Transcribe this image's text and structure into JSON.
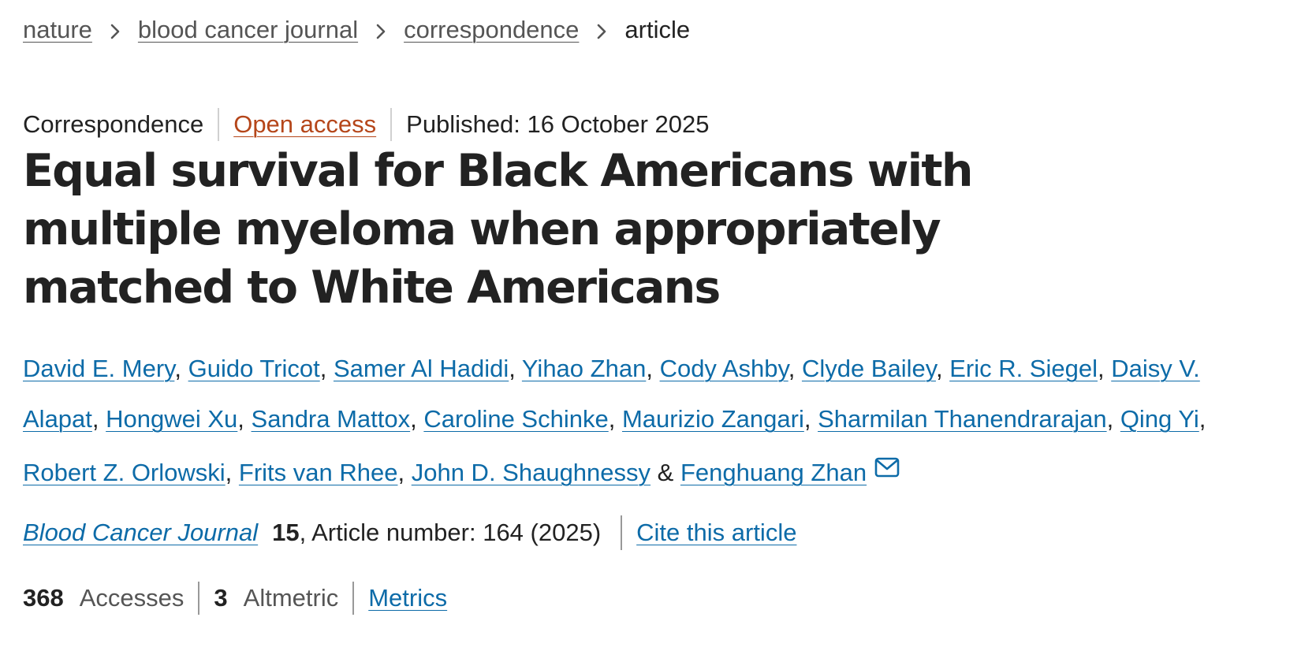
{
  "breadcrumb": {
    "items": [
      {
        "label": "nature"
      },
      {
        "label": "blood cancer journal"
      },
      {
        "label": "correspondence"
      }
    ],
    "current": "article"
  },
  "article": {
    "type": "Correspondence",
    "access": "Open access",
    "published": "Published: 16 October 2025",
    "title": "Equal survival for Black Americans with multiple myeloma when appropriately matched to White Americans"
  },
  "authors": [
    {
      "name": "David E. Mery"
    },
    {
      "name": "Guido Tricot"
    },
    {
      "name": "Samer Al Hadidi"
    },
    {
      "name": "Yihao Zhan"
    },
    {
      "name": "Cody Ashby"
    },
    {
      "name": "Clyde Bailey"
    },
    {
      "name": "Eric R. Siegel"
    },
    {
      "name": "Daisy V. Alapat"
    },
    {
      "name": "Hongwei Xu"
    },
    {
      "name": "Sandra Mattox"
    },
    {
      "name": "Caroline Schinke"
    },
    {
      "name": "Maurizio Zangari"
    },
    {
      "name": "Sharmilan Thanendrarajan"
    },
    {
      "name": "Qing Yi"
    },
    {
      "name": "Robert Z. Orlowski"
    },
    {
      "name": "Frits van Rhee"
    },
    {
      "name": "John D. Shaughnessy"
    },
    {
      "name": "Fenghuang Zhan"
    }
  ],
  "authors_separator": ", ",
  "authors_last_separator": " & ",
  "authors_contact_icon": "mail-icon",
  "citation": {
    "journal": "Blood Cancer Journal",
    "volume": "15",
    "article_number": ", Article number: 164 (2025)",
    "cite_label": "Cite this article"
  },
  "metrics": {
    "accesses_count": "368",
    "accesses_label": "Accesses",
    "altmetric_count": "3",
    "altmetric_label": "Altmetric",
    "metrics_link": "Metrics"
  },
  "colors": {
    "link": "#0d6ba8",
    "open_access": "#b5461a",
    "text": "#222222",
    "muted": "#555555"
  }
}
